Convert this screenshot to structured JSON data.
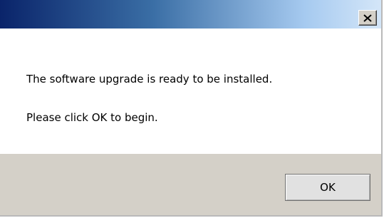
{
  "dialog": {
    "title": "",
    "close_icon": "close-icon",
    "message_line_1": "The software upgrade is ready to be installed.",
    "message_line_2": "Please click OK to begin.",
    "ok_label": "OK"
  },
  "colors": {
    "title_gradient_start": "#0a246a",
    "title_gradient_end": "#d4e6f8",
    "footer_background": "#d4d0c8",
    "button_face": "#e1e1e1"
  }
}
